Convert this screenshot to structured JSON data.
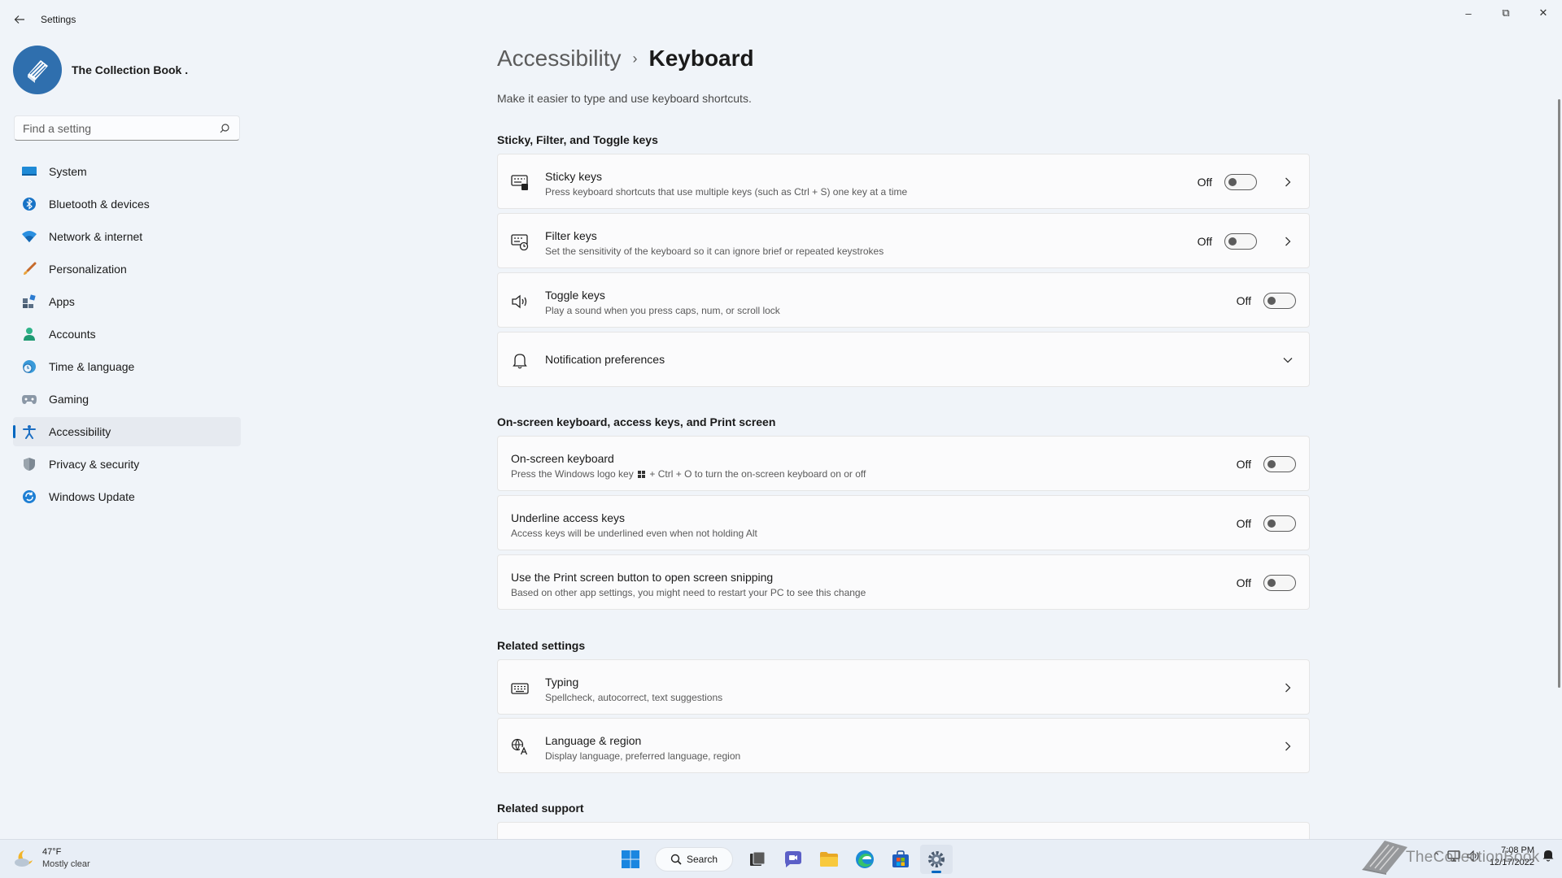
{
  "window": {
    "title": "Settings",
    "minimize": "–",
    "maximize": "⧉",
    "close": "✕"
  },
  "profile": {
    "name": "The Collection Book ."
  },
  "search": {
    "placeholder": "Find a setting"
  },
  "sidebar": {
    "items": [
      {
        "label": "System",
        "icon": "monitor-icon"
      },
      {
        "label": "Bluetooth & devices",
        "icon": "bluetooth-icon"
      },
      {
        "label": "Network & internet",
        "icon": "wifi-icon"
      },
      {
        "label": "Personalization",
        "icon": "brush-icon"
      },
      {
        "label": "Apps",
        "icon": "apps-icon"
      },
      {
        "label": "Accounts",
        "icon": "person-icon"
      },
      {
        "label": "Time & language",
        "icon": "globe-clock-icon"
      },
      {
        "label": "Gaming",
        "icon": "gamepad-icon"
      },
      {
        "label": "Accessibility",
        "icon": "accessibility-icon",
        "active": true
      },
      {
        "label": "Privacy & security",
        "icon": "shield-icon"
      },
      {
        "label": "Windows Update",
        "icon": "update-icon"
      }
    ]
  },
  "breadcrumb": {
    "parent": "Accessibility",
    "separator": "›",
    "current": "Keyboard"
  },
  "page_description": "Make it easier to type and use keyboard shortcuts.",
  "sections": {
    "sticky": {
      "title": "Sticky, Filter, and Toggle keys",
      "items": [
        {
          "title": "Sticky keys",
          "subtitle": "Press keyboard shortcuts that use multiple keys (such as Ctrl + S) one key at a time",
          "state": "Off",
          "has_chevron": true,
          "icon": "sticky-keys-icon"
        },
        {
          "title": "Filter keys",
          "subtitle": "Set the sensitivity of the keyboard so it can ignore brief or repeated keystrokes",
          "state": "Off",
          "has_chevron": true,
          "icon": "filter-keys-icon"
        },
        {
          "title": "Toggle keys",
          "subtitle": "Play a sound when you press caps, num, or scroll lock",
          "state": "Off",
          "has_chevron": false,
          "icon": "speaker-icon"
        },
        {
          "title": "Notification preferences",
          "icon": "bell-icon",
          "expand": "chevron-down"
        }
      ]
    },
    "onscreen": {
      "title": "On-screen keyboard, access keys, and Print screen",
      "items": [
        {
          "title": "On-screen keyboard",
          "subtitle_before": "Press the Windows logo key",
          "subtitle_after": "+ Ctrl + O to turn the on-screen keyboard on or off",
          "state": "Off"
        },
        {
          "title": "Underline access keys",
          "subtitle": "Access keys will be underlined even when not holding Alt",
          "state": "Off"
        },
        {
          "title": "Use the Print screen button to open screen snipping",
          "subtitle": "Based on other app settings, you might need to restart your PC to see this change",
          "state": "Off"
        }
      ]
    },
    "related": {
      "title": "Related settings",
      "items": [
        {
          "title": "Typing",
          "subtitle": "Spellcheck, autocorrect, text suggestions",
          "icon": "keyboard-icon"
        },
        {
          "title": "Language & region",
          "subtitle": "Display language, preferred language, region",
          "icon": "language-icon"
        }
      ]
    },
    "support": {
      "title": "Related support"
    }
  },
  "taskbar": {
    "weather": {
      "temp": "47°F",
      "condition": "Mostly clear"
    },
    "search_label": "Search",
    "apps": [
      "start-icon",
      "search",
      "task-view-icon",
      "teams-chat-icon",
      "file-explorer-icon",
      "edge-icon",
      "store-icon",
      "settings-icon"
    ],
    "clock": {
      "time": "7:08 PM",
      "date": "12/17/2022"
    }
  },
  "watermark": {
    "text": "TheCollectionBook"
  },
  "colors": {
    "accent": "#0067c0",
    "background": "#f0f4f9",
    "card": "#fbfbfc"
  }
}
